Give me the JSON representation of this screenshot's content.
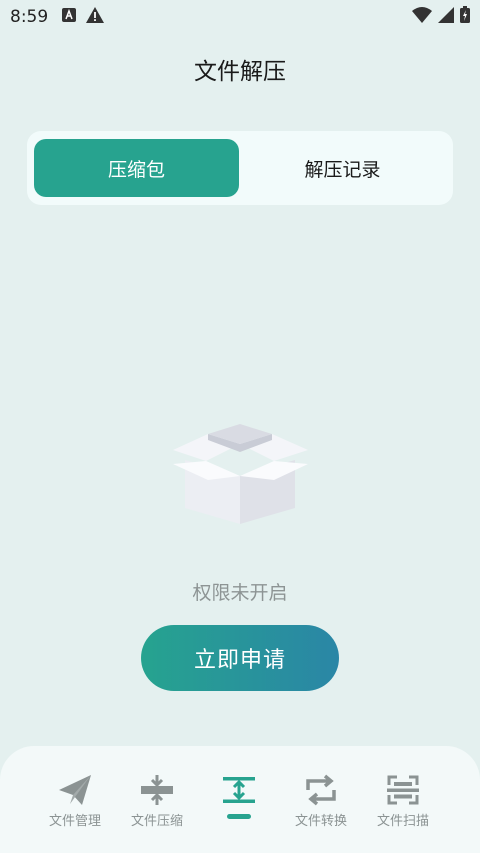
{
  "status_bar": {
    "time": "8:59"
  },
  "header": {
    "title": "文件解压"
  },
  "tabs": [
    {
      "label": "压缩包",
      "active": true
    },
    {
      "label": "解压记录",
      "active": false
    }
  ],
  "empty_state": {
    "icon": "open-box-icon",
    "message": "权限未开启",
    "button_label": "立即申请"
  },
  "bottom_nav": [
    {
      "label": "文件管理",
      "icon": "paper-plane-icon"
    },
    {
      "label": "文件压缩",
      "icon": "compress-icon"
    },
    {
      "label": "",
      "icon": "decompress-icon",
      "active": true
    },
    {
      "label": "文件转换",
      "icon": "convert-icon"
    },
    {
      "label": "文件扫描",
      "icon": "scan-icon"
    }
  ],
  "colors": {
    "accent": "#27a38f",
    "gradient_end": "#2a86a6",
    "background": "#e4f0ef",
    "inactive": "#8b9393"
  }
}
